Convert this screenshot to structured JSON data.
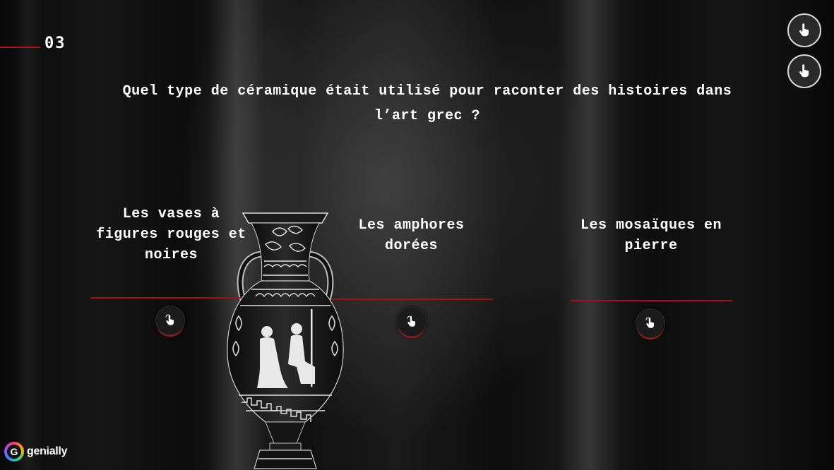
{
  "slide": {
    "number": "03",
    "question": "Quel type de céramique était utilisé pour raconter des histoires dans l’art grec ?"
  },
  "answers": [
    {
      "label": "Les vases à figures rouges et noires",
      "icon": "hand-pointer-icon"
    },
    {
      "label": "Les amphores dorées",
      "icon": "hand-pointer-icon"
    },
    {
      "label": "Les mosaïques en pierre",
      "icon": "hand-pointer-icon"
    }
  ],
  "corner_buttons": [
    {
      "icon": "hand-pointer-icon"
    },
    {
      "icon": "hand-pointer-icon"
    }
  ],
  "branding": {
    "logo_text": "genially",
    "logo_mark": "G"
  },
  "colors": {
    "accent": "#b3121a",
    "text": "#ffffff",
    "background": "#0b0b0b"
  }
}
